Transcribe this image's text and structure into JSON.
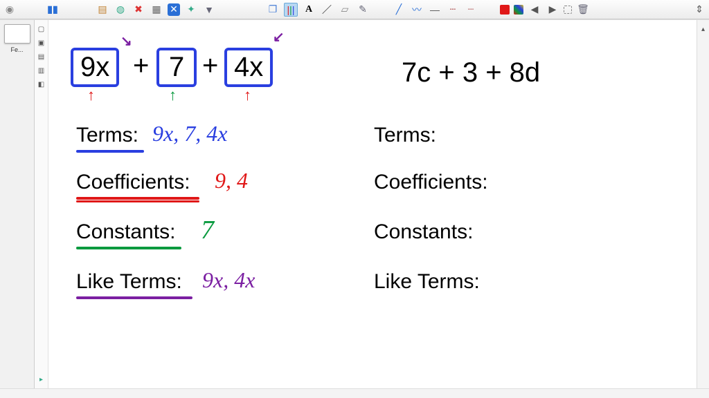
{
  "sidebar": {
    "thumb_label": "Fe..."
  },
  "left": {
    "expr": {
      "term1": "9x",
      "term2": "7",
      "term3": "4x",
      "plus": "+"
    },
    "rows": {
      "terms_label": "Terms:",
      "terms_value": "9x, 7, 4x",
      "coeff_label": "Coefficients:",
      "coeff_value": "9, 4",
      "const_label": "Constants:",
      "const_value": "7",
      "like_label": "Like Terms:",
      "like_value": "9x, 4x"
    }
  },
  "right": {
    "expr": "7c + 3 + 8d",
    "rows": {
      "terms_label": "Terms:",
      "coeff_label": "Coefficients:",
      "const_label": "Constants:",
      "like_label": "Like Terms:"
    }
  },
  "colors": {
    "blue": "#2a3fe0",
    "red": "#e01818",
    "green": "#0a9a3f",
    "purple": "#7b1fa2"
  }
}
